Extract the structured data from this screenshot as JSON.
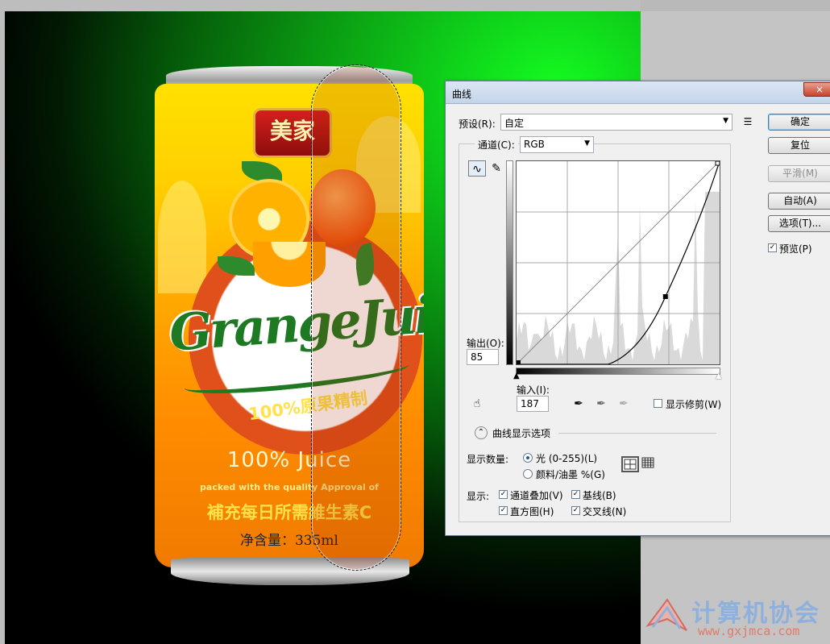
{
  "canvas": {
    "can": {
      "logo_text": "美家",
      "brand_text": "GrangeJuice",
      "arc_text": "100%原果精制",
      "line1": "100% Juice",
      "line2": "packed with the quality Approval of",
      "line3": "補充每日所需維生素C",
      "line4": "净含量：335ml"
    }
  },
  "dialog": {
    "title": "曲线",
    "close_label": "×",
    "preset_label": "预设(R):",
    "preset_value": "自定",
    "channel_label": "通道(C):",
    "channel_value": "RGB",
    "output_label": "输出(O):",
    "output_value": "85",
    "input_label": "输入(I):",
    "input_value": "187",
    "show_clipping_label": "显示修剪(W)",
    "curve_options_label": "曲线显示选项",
    "show_amount_label": "显示数量:",
    "light_option": "光 (0-255)(L)",
    "pigment_option": "颜料/油墨 %(G)",
    "show_label": "显示:",
    "channel_overlays": "通道叠加(V)",
    "baseline": "基线(B)",
    "histogram": "直方图(H)",
    "intersection": "交叉线(N)",
    "buttons": {
      "ok": "确定",
      "reset": "复位",
      "smooth": "平滑(M)",
      "auto": "自动(A)",
      "options": "选项(T)...",
      "preview": "预览(P)"
    },
    "curve_point": {
      "input": 187,
      "output": 85
    }
  },
  "watermark": {
    "title": "计算机协会",
    "url": "www.gxjmca.com"
  }
}
